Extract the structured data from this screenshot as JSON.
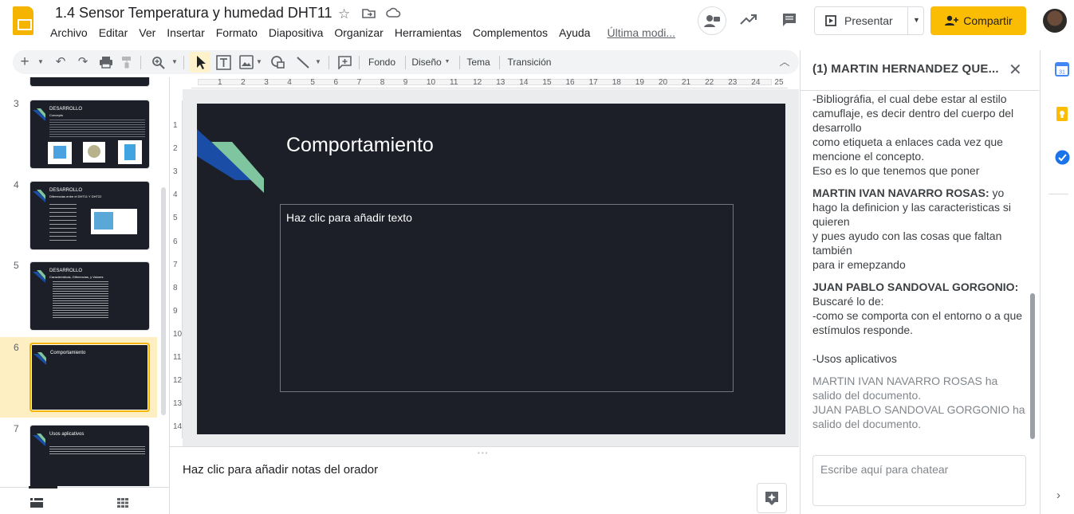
{
  "app": {
    "title": "1.4 Sensor Temperatura y humedad DHT11",
    "last_edit": "Última modi...",
    "menu": [
      "Archivo",
      "Editar",
      "Ver",
      "Insertar",
      "Formato",
      "Diapositiva",
      "Organizar",
      "Herramientas",
      "Complementos",
      "Ayuda"
    ],
    "present_label": "Presentar",
    "share_label": "Compartir"
  },
  "toolbar": {
    "fondo": "Fondo",
    "diseno": "Diseño",
    "tema": "Tema",
    "transicion": "Transición"
  },
  "filmstrip": {
    "slides": [
      {
        "number": "3",
        "title": "DESARROLLO",
        "subtitle": "Concepto"
      },
      {
        "number": "4",
        "title": "DESARROLLO",
        "subtitle": "Diferencias entre el DHT11 Y DHT22"
      },
      {
        "number": "5",
        "title": "DESARROLLO",
        "subtitle": "Características, Diferencias, y Valores"
      },
      {
        "number": "6",
        "title": "Comportamiento",
        "subtitle": ""
      },
      {
        "number": "7",
        "title": "Usos aplicativos",
        "subtitle": ""
      }
    ]
  },
  "slide": {
    "title": "Comportamiento",
    "body_placeholder": "Haz clic para añadir texto",
    "accent_dark": "#1a4ea6",
    "accent_light": "#7fc5a0",
    "background": "#1d1f28"
  },
  "notes": {
    "placeholder": "Haz clic para añadir notas del orador"
  },
  "chat": {
    "title": "(1) MARTIN HERNANDEZ QUE...",
    "messages": [
      {
        "author": "",
        "text": "-Bibliográfia, el cual debe estar al estilo camuflaje, es decir dentro del cuerpo del desarrollo\ncomo etiqueta a enlaces cada vez que mencione el concepto.\nEso es lo que tenemos que poner"
      },
      {
        "author": "MARTIN IVAN NAVARRO ROSAS:",
        "text": " yo hago la definicion y las caracteristicas si quieren\ny pues ayudo con las cosas que faltan también\npara ir emepzando"
      },
      {
        "author": "JUAN PABLO SANDOVAL GORGONIO:",
        "text": " Buscaré lo de:\n-como se comporta con el entorno o a que estímulos responde.\n\n-Usos aplicativos"
      }
    ],
    "system": [
      "MARTIN IVAN NAVARRO ROSAS ha salido del documento.",
      "JUAN PABLO SANDOVAL GORGONIO ha salido del documento."
    ],
    "input_placeholder": "Escribe aquí para chatear"
  },
  "rulers": {
    "top": [
      "1",
      "2",
      "3",
      "4",
      "5",
      "6",
      "7",
      "8",
      "9",
      "10",
      "11",
      "12",
      "13",
      "14",
      "15",
      "16",
      "17",
      "18",
      "19",
      "20",
      "21",
      "22",
      "23",
      "24",
      "25"
    ],
    "left": [
      "1",
      "2",
      "3",
      "4",
      "5",
      "6",
      "7",
      "8",
      "9",
      "10",
      "11",
      "12",
      "13",
      "14"
    ]
  }
}
